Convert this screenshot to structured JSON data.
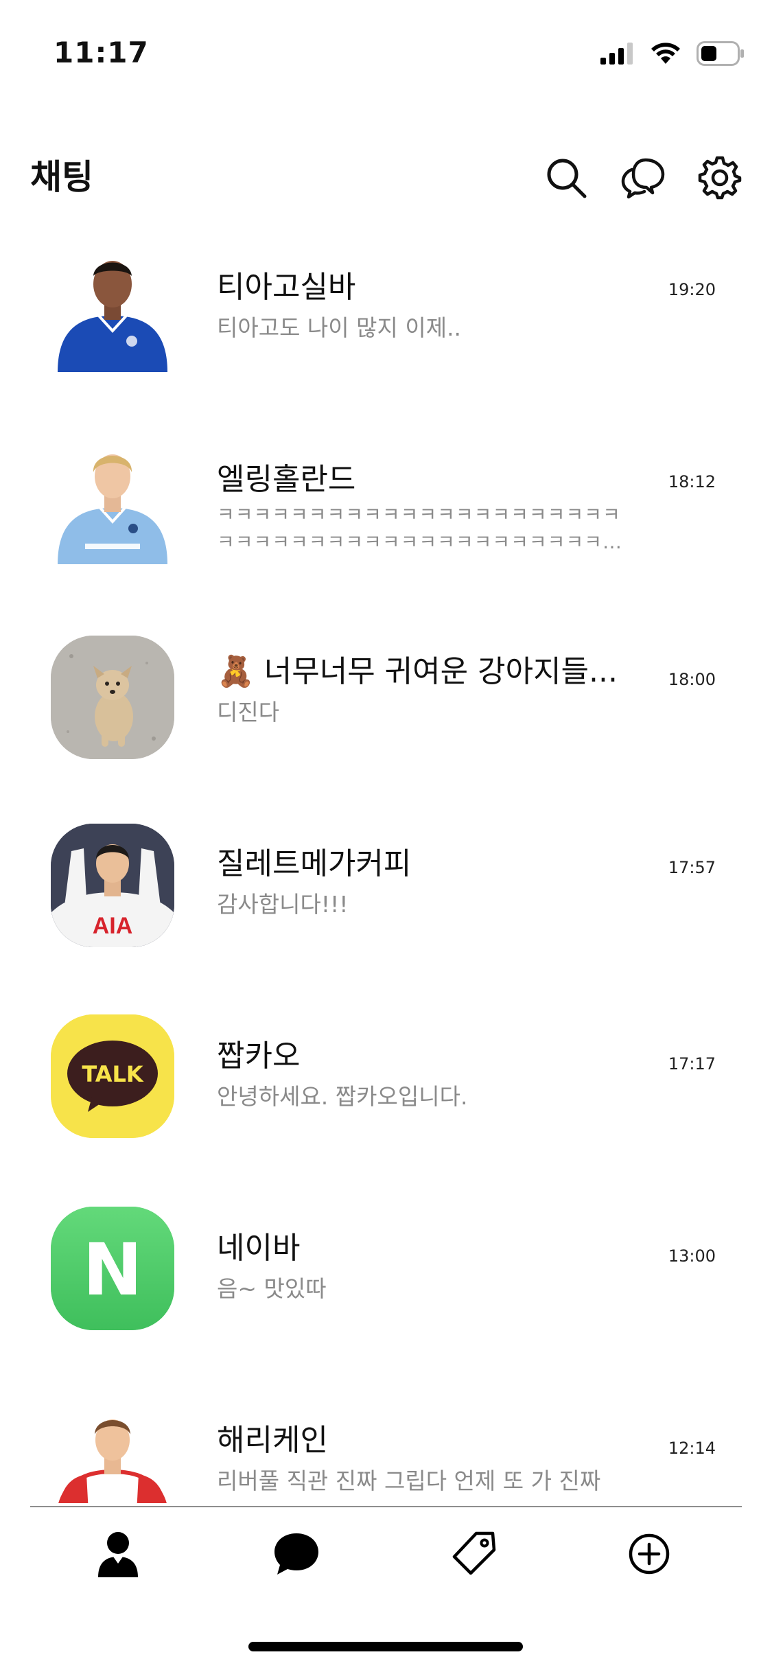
{
  "status_bar": {
    "time": "11:17",
    "icons": [
      "signal-icon",
      "wifi-icon",
      "battery-icon"
    ]
  },
  "header": {
    "title": "채팅",
    "actions": [
      "search-icon",
      "new-chat-icon",
      "settings-icon"
    ]
  },
  "chats": [
    {
      "name": "티아고실바",
      "preview": "티아고도 나이 많지 이제..",
      "time": "19:20",
      "avatar": "player-blue-kit"
    },
    {
      "name": "엘링홀란드",
      "preview": "ㅋㅋㅋㅋㅋㅋㅋㅋㅋㅋㅋㅋㅋㅋㅋㅋㅋㅋㅋㅋㅋㅋㅋㅋㅋㅋㅋㅋㅋㅋㅋㅋㅋㅋㅋㅋㅋㅋㅋㅋㅋㅋㅋ…",
      "time": "18:12",
      "avatar": "player-skyblue-kit"
    },
    {
      "name": "🧸 너무너무 귀여운 강아지들...",
      "preview": "디진다",
      "time": "18:00",
      "avatar": "puppy-photo"
    },
    {
      "name": "질레트메가커피",
      "preview": "감사합니다!!!",
      "time": "17:57",
      "avatar": "player-white-kit-aia"
    },
    {
      "name": "짭카오",
      "preview": "안녕하세요. 짭카오입니다.",
      "time": "17:17",
      "avatar": "talk-logo",
      "avatar_badge": "TALK"
    },
    {
      "name": "네이바",
      "preview": "음~ 맛있따",
      "time": "13:00",
      "avatar": "n-logo",
      "avatar_badge": "N"
    },
    {
      "name": "해리케인",
      "preview": "리버풀 직관 진짜 그립다 언제 또 가 진짜",
      "time": "12:14",
      "avatar": "player-red-kit"
    }
  ],
  "tab_bar": {
    "items": [
      "friends-icon",
      "chats-icon",
      "shopping-tag-icon",
      "more-plus-icon"
    ],
    "active": "chats-icon"
  },
  "colors": {
    "talk_yellow": "#f7e34a",
    "talk_brown": "#3c1e1e",
    "naver_green": "#4fcf6a",
    "chelsea_blue": "#1b4bb5",
    "city_sky": "#8fbde8",
    "bayern_red": "#dc2f2f"
  }
}
